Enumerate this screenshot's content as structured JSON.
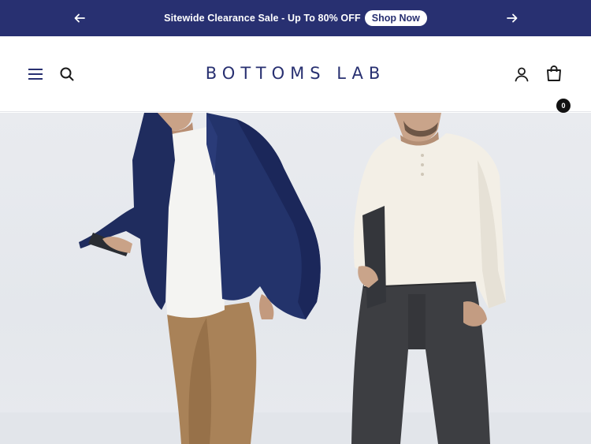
{
  "announcement": {
    "text": "Sitewide Clearance Sale - Up To 80% OFF",
    "cta": "Shop Now",
    "prev_icon": "arrow-left-icon",
    "next_icon": "arrow-right-icon",
    "background_color": "#283071"
  },
  "header": {
    "logo": "BOTTOMS LAB",
    "cart_count": "0",
    "icons": [
      "hamburger-menu-icon",
      "search-icon",
      "account-icon",
      "cart-icon"
    ],
    "brand_color": "#283071"
  },
  "hero": {
    "image": "two-men-walking-photo",
    "left_figure": "navy-blazer-khaki-pants",
    "right_figure": "cream-henley-charcoal-pants"
  }
}
